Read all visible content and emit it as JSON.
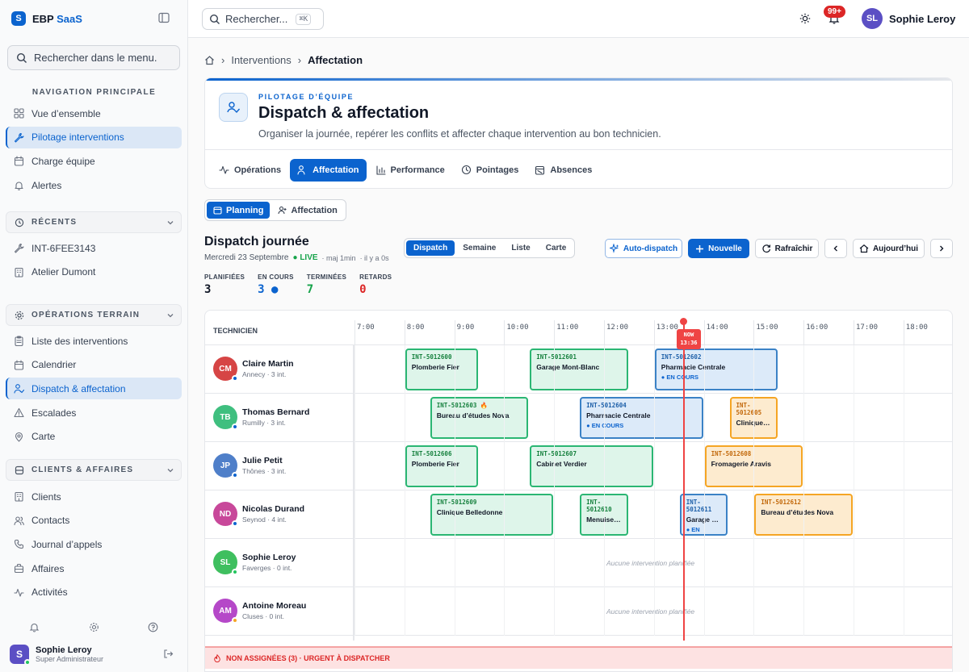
{
  "brand": {
    "letter": "S",
    "name": "EBP",
    "accent": "SaaS"
  },
  "sidebar": {
    "search_placeholder": "Rechercher dans le menu.",
    "main_heading": "NAVIGATION PRINCIPALE",
    "main_items": [
      {
        "label": "Vue d’ensemble",
        "icon": "grid-icon"
      },
      {
        "label": "Pilotage interventions",
        "icon": "wrench-icon"
      },
      {
        "label": "Charge équipe",
        "icon": "calendar-icon"
      },
      {
        "label": "Alertes",
        "icon": "bell-icon"
      }
    ],
    "recent_heading": "RÉCENTS",
    "recent_items": [
      {
        "label": "INT-6FEE3143",
        "icon": "wrench-icon"
      },
      {
        "label": "Atelier Dumont",
        "icon": "building-icon"
      }
    ],
    "ops_heading": "OPÉRATIONS TERRAIN",
    "ops_items": [
      {
        "label": "Liste des interventions",
        "icon": "clipboard-icon"
      },
      {
        "label": "Calendrier",
        "icon": "calendar-icon"
      },
      {
        "label": "Dispatch & affectation",
        "icon": "user-check-icon"
      },
      {
        "label": "Escalades",
        "icon": "warning-icon"
      },
      {
        "label": "Carte",
        "icon": "map-pin-icon"
      }
    ],
    "clients_heading": "CLIENTS & AFFAIRES",
    "clients_items": [
      {
        "label": "Clients",
        "icon": "building-icon"
      },
      {
        "label": "Contacts",
        "icon": "users-icon"
      },
      {
        "label": "Journal d’appels",
        "icon": "phone-icon"
      },
      {
        "label": "Affaires",
        "icon": "briefcase-icon"
      },
      {
        "label": "Activités",
        "icon": "activity-icon"
      }
    ],
    "user": {
      "initial": "S",
      "name": "Sophie Leroy",
      "role": "Super Administrateur"
    }
  },
  "topbar": {
    "search_placeholder": "Rechercher...",
    "shortcut": "⌘K",
    "notifications_badge": "99+",
    "user": {
      "initials": "SL",
      "name": "Sophie Leroy"
    }
  },
  "breadcrumb": {
    "items": [
      "Interventions",
      "Affectation"
    ]
  },
  "header": {
    "kicker": "PILOTAGE D’ÉQUIPE",
    "title": "Dispatch & affectation",
    "subtitle": "Organiser la journée, repérer les conflits et affecter chaque intervention au bon technicien.",
    "tabs": [
      "Opérations",
      "Affectation",
      "Performance",
      "Pointages",
      "Absences"
    ],
    "active_tab": "Affectation"
  },
  "mode_toggle": {
    "options": [
      "Planning",
      "Affectation"
    ],
    "active": "Planning"
  },
  "dispatch": {
    "title": "Dispatch journée",
    "date": "Mercredi 23 Septembre",
    "live": "● LIVE",
    "updated": "· maj 1min",
    "ago": "· il y a 0s",
    "views": [
      "Dispatch",
      "Semaine",
      "Liste",
      "Carte"
    ],
    "active_view": "Dispatch",
    "actions": {
      "auto": "Auto-dispatch",
      "new": "Nouvelle",
      "refresh": "Rafraîchir",
      "today": "Aujourd’hui"
    },
    "stats": [
      {
        "label": "PLANIFIÉES",
        "value": "3",
        "color": "#111827"
      },
      {
        "label": "EN COURS",
        "value": "3 ●",
        "color": "#0b63ce"
      },
      {
        "label": "TERMINÉES",
        "value": "7",
        "color": "#16a34a"
      },
      {
        "label": "RETARDS",
        "value": "0",
        "color": "#dc2626"
      }
    ]
  },
  "gantt": {
    "tech_header": "TECHNICIEN",
    "hours": [
      "7:00",
      "8:00",
      "9:00",
      "10:00",
      "11:00",
      "12:00",
      "13:00",
      "14:00",
      "15:00",
      "16:00",
      "17:00",
      "18:00"
    ],
    "now": {
      "label": "NOW",
      "time": "13:36"
    },
    "empty_message": "Aucune intervention planifiée",
    "technicians": [
      {
        "initials": "CM",
        "name": "Claire Martin",
        "meta": "Annecy · 3 int.",
        "avatar": "#d64545",
        "status": "#0b63ce",
        "jobs": [
          {
            "id": "INT-5012600",
            "client": "Plomberie Fier",
            "start": 8.0,
            "end": 9.5,
            "color": "green"
          },
          {
            "id": "INT-5012601",
            "client": "Garage Mont-Blanc",
            "start": 10.5,
            "end": 12.5,
            "color": "green"
          },
          {
            "id": "INT-5012602",
            "client": "Pharmacie Centrale",
            "start": 13.0,
            "end": 15.5,
            "color": "blue",
            "status": "● EN COURS"
          }
        ]
      },
      {
        "initials": "TB",
        "name": "Thomas Bernard",
        "meta": "Rumilly · 3 int.",
        "avatar": "#3fbf7f",
        "status": "#0b63ce",
        "jobs": [
          {
            "id": "INT-5012603 🔥",
            "client": "Bureau d’études Nova",
            "start": 8.5,
            "end": 10.5,
            "color": "green"
          },
          {
            "id": "INT-5012604",
            "client": "Pharmacie Centrale",
            "start": 11.5,
            "end": 14.0,
            "color": "blue",
            "status": "● EN COURS"
          },
          {
            "id": "INT-5012605",
            "client": "Clinique Belledonne",
            "start": 14.5,
            "end": 15.5,
            "color": "orange"
          }
        ]
      },
      {
        "initials": "JP",
        "name": "Julie Petit",
        "meta": "Thônes · 3 int.",
        "avatar": "#4f7fc9",
        "status": "#0b63ce",
        "jobs": [
          {
            "id": "INT-5012606",
            "client": "Plomberie Fier",
            "start": 8.0,
            "end": 9.5,
            "color": "green"
          },
          {
            "id": "INT-5012607",
            "client": "Cabinet Verdier",
            "start": 10.5,
            "end": 13.0,
            "color": "green"
          },
          {
            "id": "INT-5012608",
            "client": "Fromagerie Aravis",
            "start": 14.0,
            "end": 16.0,
            "color": "orange"
          }
        ]
      },
      {
        "initials": "ND",
        "name": "Nicolas Durand",
        "meta": "Seynod · 4 int.",
        "avatar": "#c8489a",
        "status": "#0b63ce",
        "jobs": [
          {
            "id": "INT-5012609",
            "client": "Clinique Belledonne",
            "start": 8.5,
            "end": 11.0,
            "color": "green"
          },
          {
            "id": "INT-5012610",
            "client": "Menuiserie Alpes",
            "start": 11.5,
            "end": 12.5,
            "color": "green"
          },
          {
            "id": "INT-5012611",
            "client": "Garage Mont-Blanc",
            "start": 13.5,
            "end": 14.5,
            "color": "blue",
            "status": "● EN COURS"
          },
          {
            "id": "INT-5012612",
            "client": "Bureau d’études Nova",
            "start": 15.0,
            "end": 17.0,
            "color": "orange"
          }
        ]
      },
      {
        "initials": "SL",
        "name": "Sophie Leroy",
        "meta": "Faverges · 0 int.",
        "avatar": "#3fbf5f",
        "status": "#22c55e",
        "jobs": []
      },
      {
        "initials": "AM",
        "name": "Antoine Moreau",
        "meta": "Cluses · 0 int.",
        "avatar": "#b548c8",
        "status": "#f5a524",
        "jobs": []
      }
    ],
    "unassigned": "NON ASSIGNÉES (3) · URGENT À DISPATCHER"
  }
}
